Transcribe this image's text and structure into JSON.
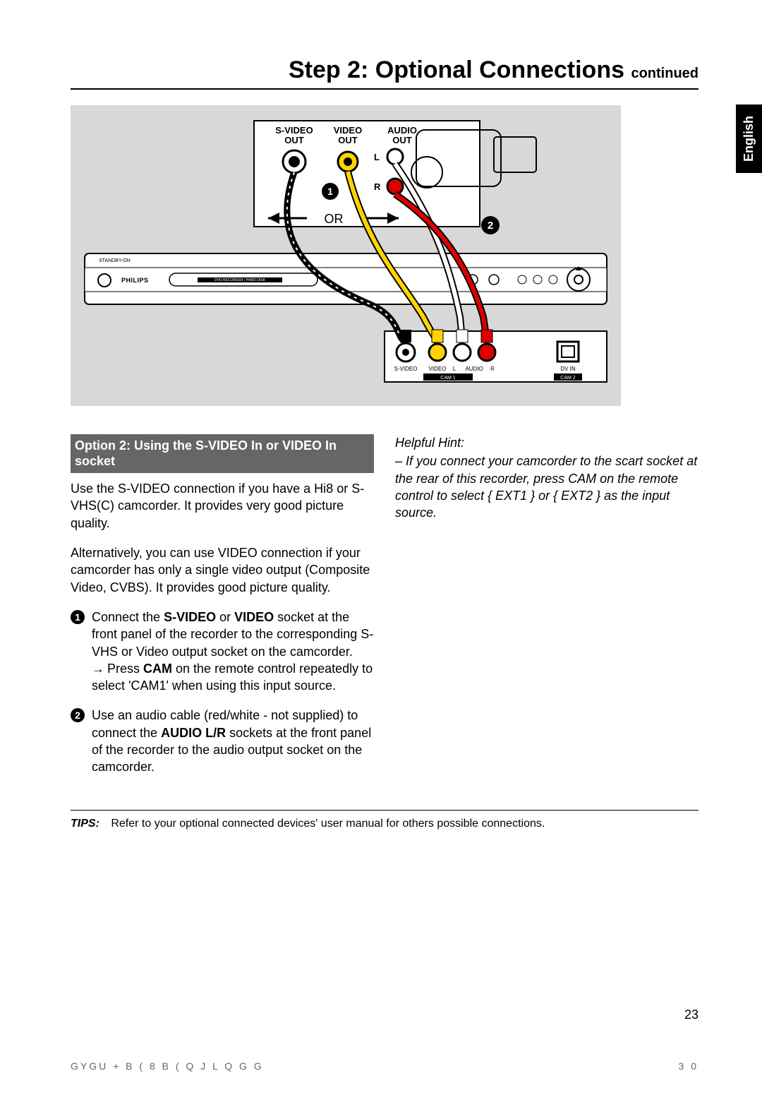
{
  "title": {
    "main": "Step 2: Optional Connections ",
    "continued": "continued"
  },
  "language_tab": "English",
  "diagram": {
    "labels": {
      "svideo_out": "S-VIDEO",
      "video_out": "VIDEO",
      "audio_out": "AUDIO",
      "out": "OUT",
      "l": "L",
      "r": "R",
      "or": "OR",
      "badge1": "1",
      "badge2": "2",
      "brand": "PHILIPS",
      "device_label": "DVD RECORDER / HARD DISK",
      "panel_svideo": "S-VIDEO",
      "panel_video": "VIDEO",
      "panel_l": "L",
      "panel_audio": "AUDIO",
      "panel_r": "R",
      "panel_dvin": "DV IN",
      "panel_cam1": "CAM 1",
      "panel_cam2": "CAM 2",
      "standby": "STANDBY-ON"
    }
  },
  "left": {
    "option_header": "Option 2: Using the S-VIDEO In or VIDEO In socket",
    "p1": "Use the S-VIDEO connection if you have a Hi8 or S-VHS(C) camcorder. It provides very good picture quality.",
    "p2": "Alternatively, you can use VIDEO connection if your camcorder has only a single video output (Composite Video, CVBS). It provides good picture quality.",
    "s1a": "Connect the ",
    "s1b": "S-VIDEO",
    "s1c": " or ",
    "s1d": "VIDEO",
    "s1e": " socket at the front panel of the recorder to the corresponding S-VHS or Video output socket on the camcorder.",
    "s1fa": "Press ",
    "s1fb": "CAM",
    "s1fc": " on the remote control repeatedly to select 'CAM1' when using this input source.",
    "s2a": "Use an audio cable (red/white - not supplied) to connect the ",
    "s2b": "AUDIO L/R",
    "s2c": " sockets at the front panel of the recorder to the audio output socket on the camcorder.",
    "badge1": "1",
    "badge2": "2"
  },
  "right": {
    "hint_title": "Helpful Hint:",
    "hint_body": "– If you connect your camcorder to the scart socket at the rear of this recorder, press CAM on the remote control to select { EXT1 } or { EXT2 } as the input source."
  },
  "tips": {
    "label": "TIPS:",
    "text": "Refer to your optional connected devices' user manual for others possible connections."
  },
  "page_num": "23",
  "footer": {
    "left": "GYGU   + B ( 8 B ( Q J    L Q G G",
    "right": "3 0"
  }
}
